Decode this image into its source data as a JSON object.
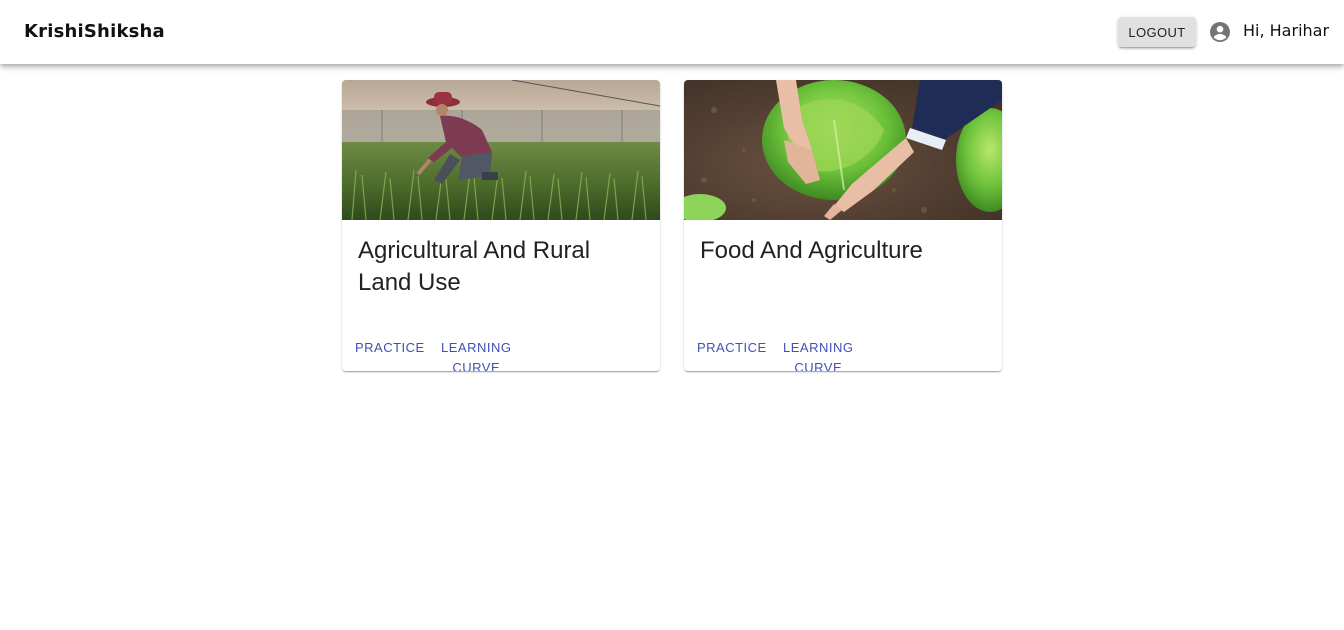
{
  "app": {
    "brand": "KrishiShiksha",
    "logout_label": "Logout",
    "greeting": "Hi, Harihar",
    "account_icon": "account-circle-icon"
  },
  "cards": [
    {
      "title": "Agricultural And Rural Land Use",
      "image": "farmer-crouching-in-field-photo",
      "practice_label": "Practice",
      "learning_curve_label": "Learning Curve"
    },
    {
      "title": "Food And Agriculture",
      "image": "hands-planting-lettuce-photo",
      "practice_label": "Practice",
      "learning_curve_label": "Learning Curve"
    }
  ],
  "colors": {
    "accent": "#3f51b5",
    "appbar_bg": "#ffffff",
    "button_bg": "#e0e0e0"
  }
}
